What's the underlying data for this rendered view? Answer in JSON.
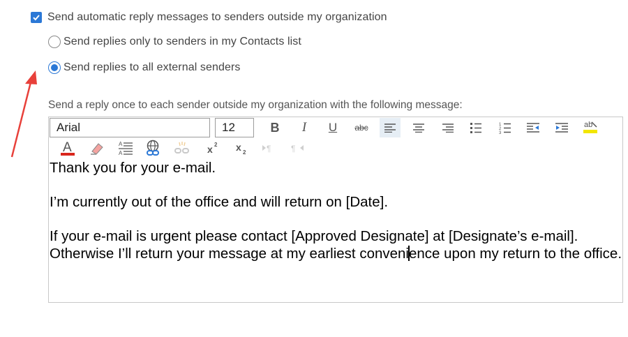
{
  "options": {
    "auto_reply_label": "Send automatic reply messages to senders outside my organization",
    "auto_reply_checked": true,
    "contacts_only_label": "Send replies only to senders in my Contacts list",
    "all_external_label": "Send replies to all external senders",
    "selected": "all_external"
  },
  "editor": {
    "label": "Send a reply once to each sender outside my organization with the following message:",
    "font_name": "Arial",
    "font_size": "12",
    "paragraphs": [
      "Thank you for your e-mail.",
      "I’m currently out of the office and will return on [Date].",
      "If your e-mail is urgent please contact [Approved Designate] at [Designate’s e-mail]. Otherwise I’ll return your message at my earliest conveni",
      "ence upon my return to the office."
    ],
    "toolbar_icons": [
      "bold-icon",
      "italic-icon",
      "underline-icon",
      "strikethrough-icon",
      "align-left-icon",
      "align-center-icon",
      "align-right-icon",
      "bullet-list-icon",
      "numbered-list-icon",
      "decrease-indent-icon",
      "increase-indent-icon",
      "spellcheck-icon",
      "font-color-icon",
      "highlight-icon",
      "paragraph-format-icon",
      "insert-link-icon",
      "remove-link-icon",
      "superscript-icon",
      "subscript-icon",
      "ltr-icon",
      "rtl-icon"
    ]
  },
  "colors": {
    "accent": "#2b78d6",
    "annotation_arrow": "#e8403a",
    "font_color_bar": "#d9261c",
    "highlight_bar": "#f2e600"
  }
}
